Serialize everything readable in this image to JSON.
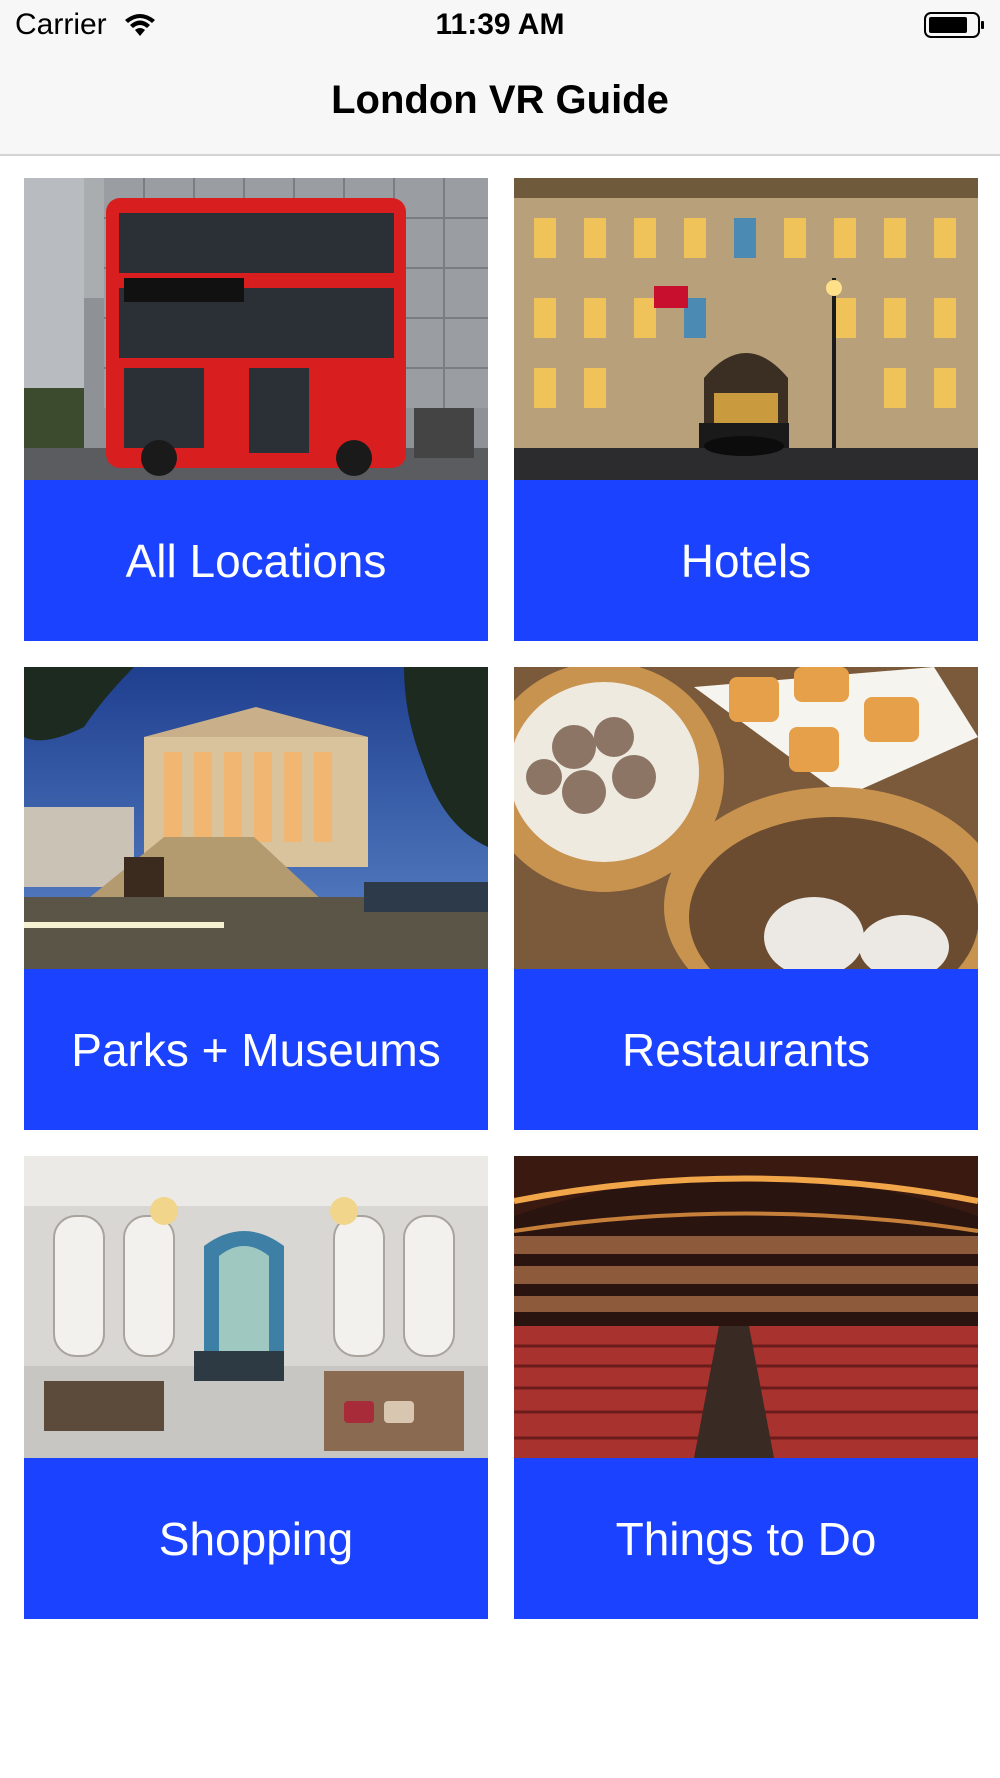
{
  "status_bar": {
    "carrier": "Carrier",
    "time": "11:39 AM",
    "wifi_icon": "wifi-icon",
    "battery_icon": "battery-icon"
  },
  "nav": {
    "title": "London VR Guide"
  },
  "tiles": [
    {
      "label": "All Locations",
      "image": "red-double-decker-bus-photo"
    },
    {
      "label": "Hotels",
      "image": "hotel-facade-night-photo"
    },
    {
      "label": "Parks + Museums",
      "image": "museum-building-dusk-photo"
    },
    {
      "label": "Restaurants",
      "image": "dim-sum-dishes-photo"
    },
    {
      "label": "Shopping",
      "image": "luxury-store-interior-photo"
    },
    {
      "label": "Things to Do",
      "image": "theatre-auditorium-photo"
    }
  ],
  "colors": {
    "tile_label_bg": "#1a42ff",
    "tile_label_text": "#ffffff",
    "nav_bg": "#f7f7f7"
  }
}
